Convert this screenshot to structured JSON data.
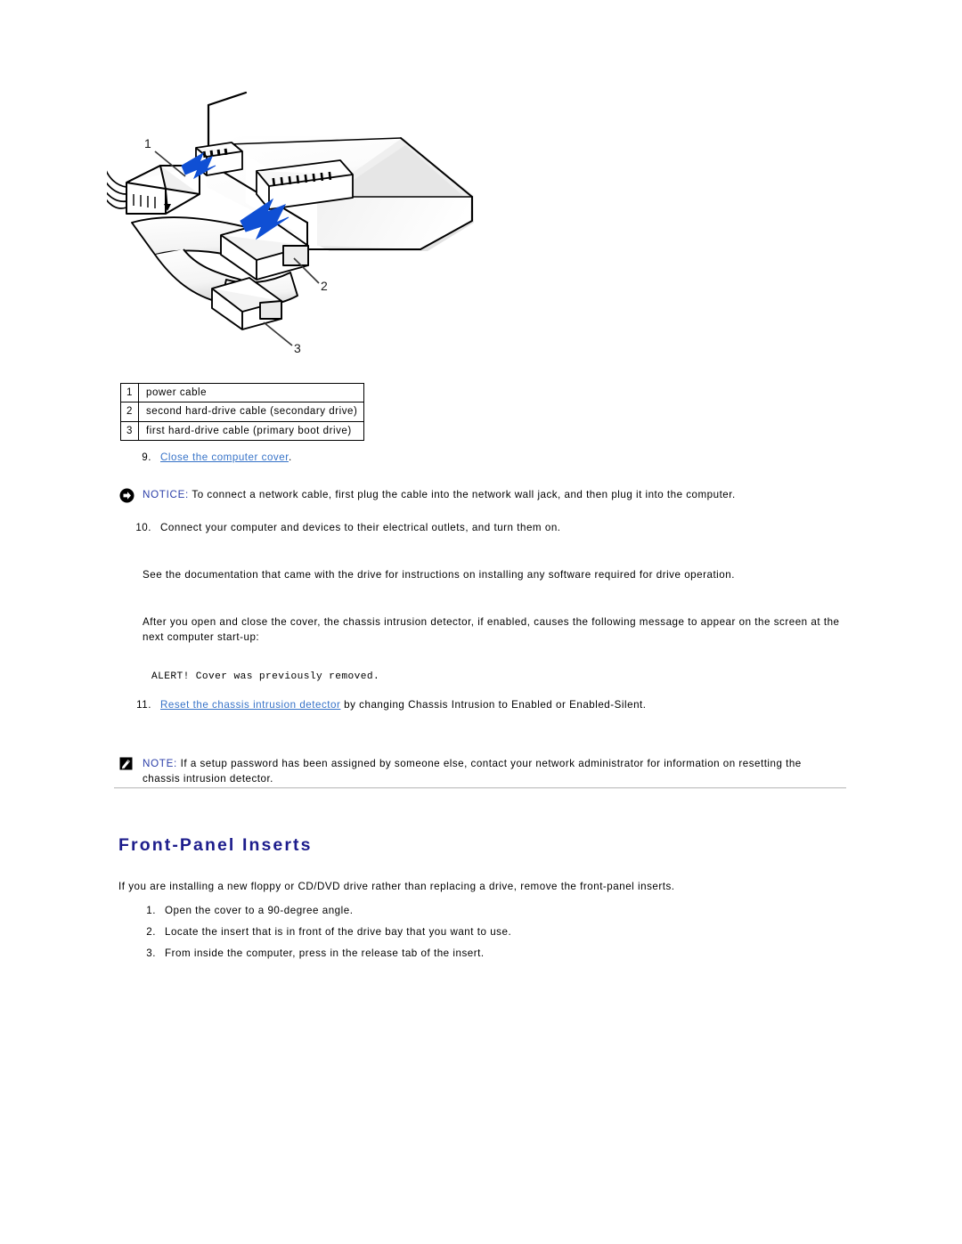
{
  "figure": {
    "alt": "Hard drive rear connectors with power cable and two hard-drive data cables",
    "callout_labels": [
      "1",
      "2",
      "3"
    ],
    "arrow_color": "#0f4fd4"
  },
  "callout_table": {
    "rows": [
      {
        "num": "1",
        "label": "power cable"
      },
      {
        "num": "2",
        "label": "second hard-drive cable (secondary drive)"
      },
      {
        "num": "3",
        "label": "first hard-drive cable (primary boot drive)"
      }
    ]
  },
  "steps": {
    "step9": {
      "marker": "9.",
      "link_text": "Close the computer cover",
      "trailing": "."
    },
    "step10": {
      "marker": "10.",
      "text": "Connect your computer and devices to their electrical outlets, and turn them on."
    },
    "step11": {
      "marker": "11.",
      "link_text": "Reset the chassis intrusion detector",
      "trailing": " by changing Chassis Intrusion to Enabled or Enabled-Silent."
    }
  },
  "paragraphs": {
    "drive_docs": "See the documentation that came with the drive for instructions on installing any software required for drive operation.",
    "intrusion": "After you open and close the cover, the chassis intrusion detector, if enabled, causes the following message to appear on the screen at the next computer start-up:"
  },
  "alert_message": "ALERT! Cover was previously removed.",
  "notice": {
    "icon": "notice-arrow-icon",
    "label": "NOTICE:",
    "text": " To connect a network cable, first plug the cable into the network wall jack, and then plug it into the computer."
  },
  "note": {
    "icon": "note-pencil-icon",
    "label": "NOTE:",
    "text": " If a setup password has been assigned by someone else, contact your network administrator for information on resetting the chassis intrusion detector."
  },
  "section": {
    "heading": "Front-Panel Inserts",
    "intro": "If you are installing a new floppy or CD/DVD drive rather than replacing a drive, remove the front-panel inserts.",
    "steps": [
      {
        "marker": "1.",
        "text": "Open the cover to a 90-degree angle."
      },
      {
        "marker": "2.",
        "text": "Locate the insert that is in front of the drive bay that you want to use."
      },
      {
        "marker": "3.",
        "text": "From inside the computer, press in the release tab of the insert."
      }
    ]
  },
  "colors": {
    "heading": "#1d1d8c",
    "link": "#3773c8",
    "admon_label": "#2b3ea8",
    "arrow": "#0f4fd4"
  }
}
